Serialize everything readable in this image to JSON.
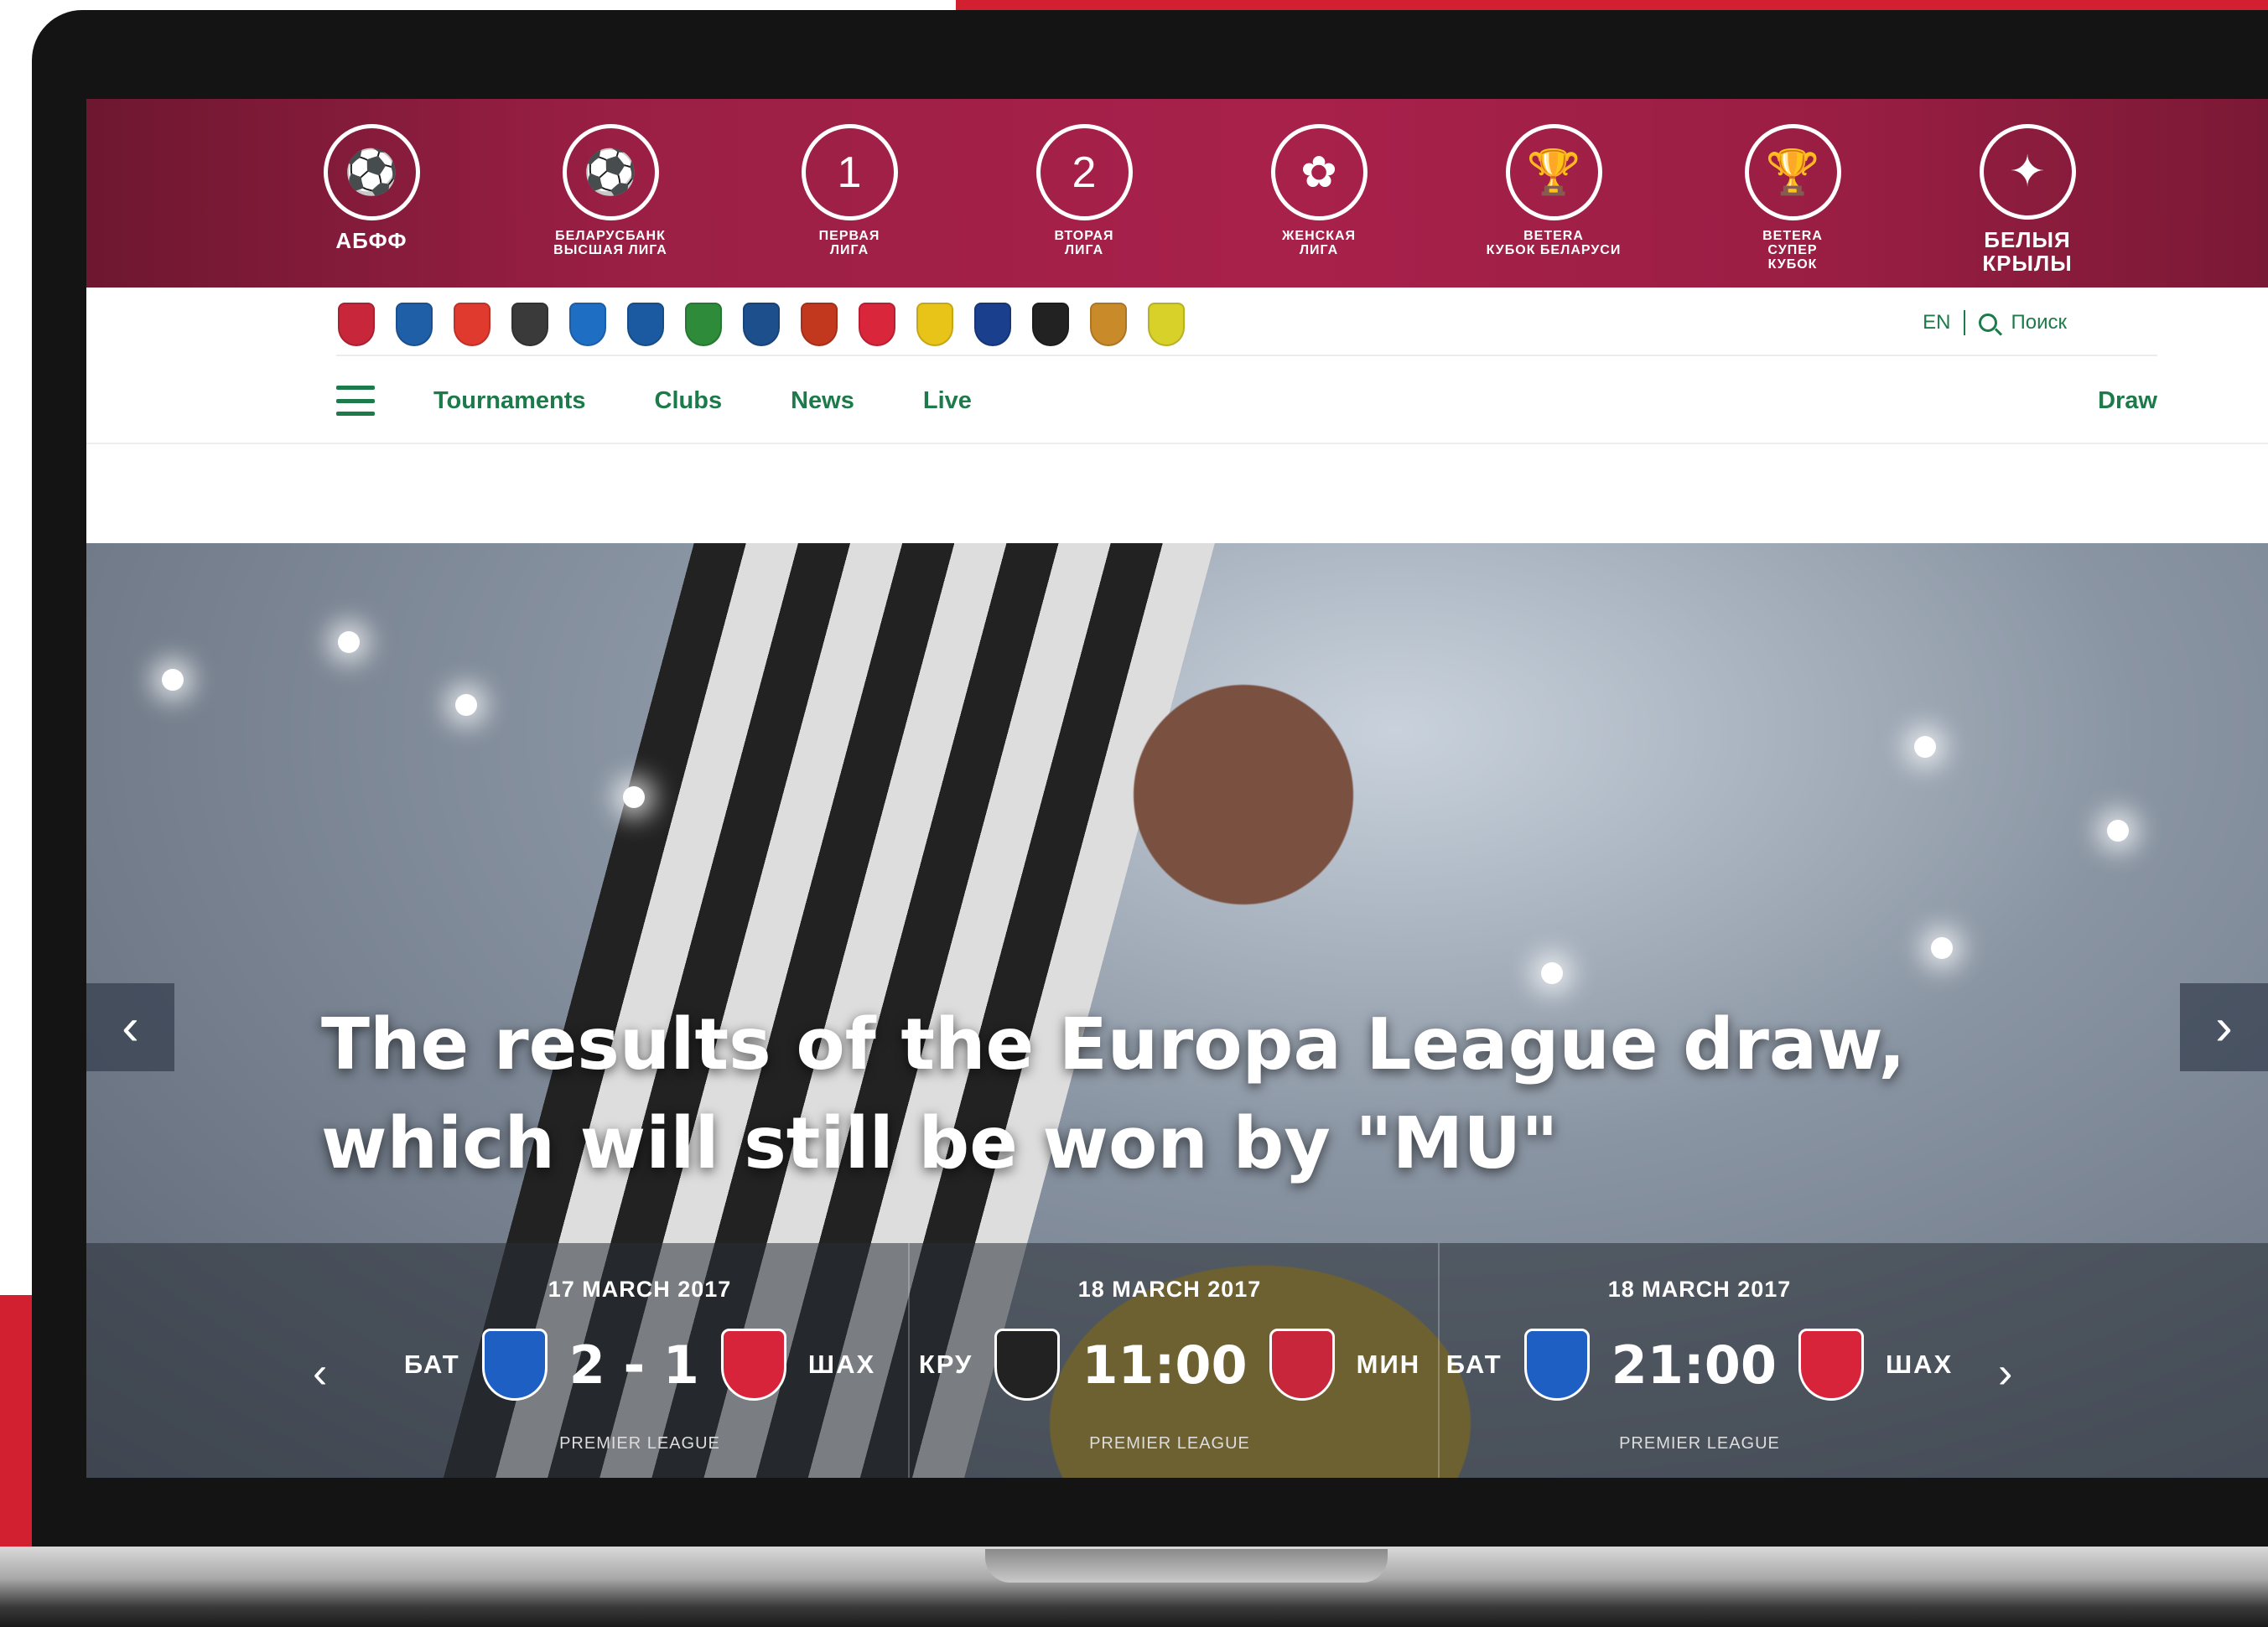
{
  "leagues": [
    {
      "name": "АБФФ",
      "color": "#ffffff"
    },
    {
      "name": "БЕЛАРУСБАНК\nВЫСШАЯ ЛИГА",
      "color": "#ffffff"
    },
    {
      "name": "ПЕРВАЯ\nЛИГА",
      "color": "#ffffff"
    },
    {
      "name": "ВТОРАЯ\nЛИГА",
      "color": "#ffffff"
    },
    {
      "name": "ЖЕНСКАЯ\nЛИГА",
      "color": "#ffffff"
    },
    {
      "name": "BETERA\nКУБОК БЕЛАРУСИ",
      "color": "#ffffff"
    },
    {
      "name": "BETERA\nСУПЕР\nКУБОК",
      "color": "#ffffff"
    },
    {
      "name": "БЕЛЫЯ КРЫЛЫ",
      "color": "#ffffff"
    }
  ],
  "clubs": [
    {
      "icon": "club-badge-1",
      "color": "#c8263a"
    },
    {
      "icon": "club-badge-2",
      "color": "#1f5fa8"
    },
    {
      "icon": "club-badge-3",
      "color": "#e03a2f"
    },
    {
      "icon": "club-badge-4",
      "color": "#3a3a3a"
    },
    {
      "icon": "club-badge-5",
      "color": "#1e6fc4"
    },
    {
      "icon": "club-badge-6",
      "color": "#1b5aa0"
    },
    {
      "icon": "club-badge-7",
      "color": "#2e8b3a"
    },
    {
      "icon": "club-badge-8",
      "color": "#1d4f8c"
    },
    {
      "icon": "club-badge-9",
      "color": "#c2381f"
    },
    {
      "icon": "club-badge-10",
      "color": "#d9263a"
    },
    {
      "icon": "club-badge-11",
      "color": "#e8c418"
    },
    {
      "icon": "club-badge-12",
      "color": "#1a3f8c"
    },
    {
      "icon": "club-badge-13",
      "color": "#222222"
    },
    {
      "icon": "club-badge-14",
      "color": "#c98a2a"
    },
    {
      "icon": "club-badge-15",
      "color": "#d8d12a"
    }
  ],
  "header": {
    "lang": "EN",
    "search_label": "Поиск"
  },
  "nav": {
    "items": [
      "Tournaments",
      "Clubs",
      "News",
      "Live"
    ],
    "draw": "Draw"
  },
  "hero": {
    "title": "The results of the Europa League draw,\nwhich will still be won by \"MU\"",
    "prev_icon": "chevron-left-icon",
    "next_icon": "chevron-right-icon"
  },
  "matches": [
    {
      "date": "17 MARCH 2017",
      "home": "БАТ",
      "away": "ШАХ",
      "score": "2 - 1",
      "league": "PREMIER LEAGUE",
      "home_color": "#1e5fc4",
      "away_color": "#d8243a"
    },
    {
      "date": "18 MARCH 2017",
      "home": "КРУ",
      "away": "МИН",
      "score": "11:00",
      "league": "PREMIER LEAGUE",
      "home_color": "#222222",
      "away_color": "#c8263a"
    },
    {
      "date": "18 MARCH 2017",
      "home": "БАТ",
      "away": "ШАХ",
      "score": "21:00",
      "league": "PREMIER LEAGUE",
      "home_color": "#1e5fc4",
      "away_color": "#d8243a"
    }
  ],
  "colors": {
    "accent": "#1d7a4a",
    "brand": "#9b1f45",
    "red": "#d32030"
  }
}
